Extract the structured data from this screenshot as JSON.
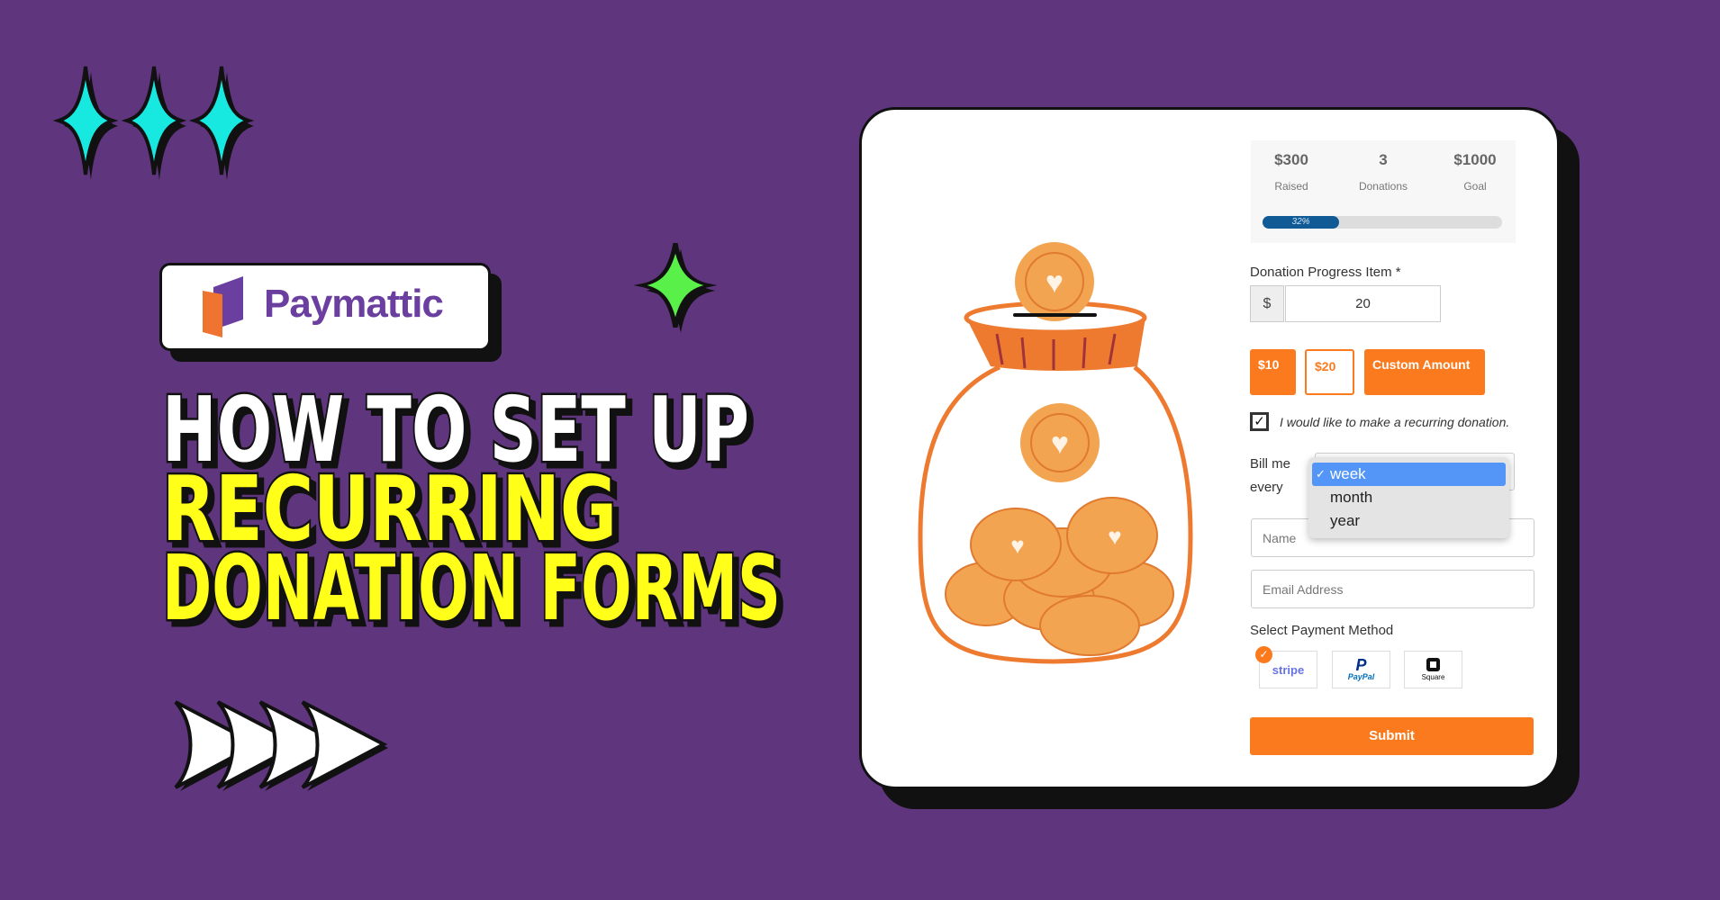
{
  "brand": {
    "name": "Paymattic"
  },
  "headline": {
    "line1": "HOW TO SET UP",
    "line2": "RECURRING",
    "line3": "DONATION FORMS"
  },
  "colors": {
    "background": "#5f367d",
    "accent": "#fb7a1e",
    "headline_white": "#ffffff",
    "headline_yellow": "#ffff1a",
    "sparkle_cyan": "#17e8e0",
    "sparkle_green": "#5af04a",
    "progress": "#105b96"
  },
  "form": {
    "stats": [
      {
        "value": "$300",
        "label": "Raised"
      },
      {
        "value": "3",
        "label": "Donations"
      },
      {
        "value": "$1000",
        "label": "Goal"
      }
    ],
    "progress": {
      "percent": 32,
      "label": "32%"
    },
    "amount_label": "Donation Progress Item *",
    "currency": "$",
    "amount_value": "20",
    "amount_buttons": [
      "$10",
      "$20",
      "Custom Amount"
    ],
    "recurring_label": "I would like to make a recurring donation.",
    "recurring_checked": true,
    "bill_label_1": "Bill me",
    "bill_label_2": "every",
    "interval_options": [
      "week",
      "month",
      "year"
    ],
    "interval_selected": "week",
    "name_placeholder": "Name",
    "email_placeholder": "Email Address",
    "payment_label": "Select Payment Method",
    "payment_methods": [
      "stripe",
      "PayPal",
      "Square"
    ],
    "payment_selected": "stripe",
    "submit_label": "Submit"
  }
}
